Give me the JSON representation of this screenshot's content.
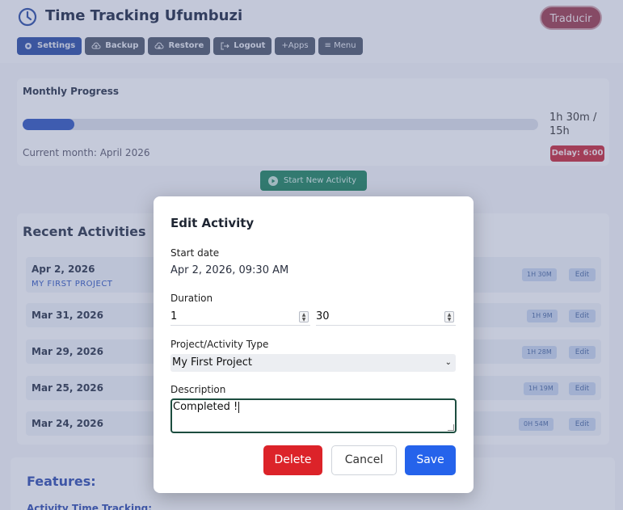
{
  "header": {
    "title": "Time Tracking Ufumbuzi",
    "translate_label": "Traducir",
    "toolbar": [
      {
        "label": "Settings",
        "icon": "gear-icon"
      },
      {
        "label": "Backup",
        "icon": "cloud-upload-icon"
      },
      {
        "label": "Restore",
        "icon": "cloud-download-icon"
      },
      {
        "label": "Logout",
        "icon": "logout-icon"
      },
      {
        "label": "+Apps",
        "icon": ""
      },
      {
        "label": "≡ Menu",
        "icon": ""
      }
    ]
  },
  "progress": {
    "title": "Monthly Progress",
    "fraction": 0.1,
    "hours_label": "1h 30m / 15h",
    "month_label": "Current month: April 2026",
    "delay_label": "Delay: 6:00"
  },
  "start_activity_label": "Start New Activity",
  "recent": {
    "title": "Recent Activities",
    "edit_label": "Edit",
    "rows": [
      {
        "date": "Apr 2, 2026",
        "project": "MY FIRST PROJECT",
        "duration": "1H 30M"
      },
      {
        "date": "Mar 31, 2026",
        "project": "",
        "duration": "1H 9M"
      },
      {
        "date": "Mar 29, 2026",
        "project": "",
        "duration": "1H 28M"
      },
      {
        "date": "Mar 25, 2026",
        "project": "",
        "duration": "1H 19M"
      },
      {
        "date": "Mar 24, 2026",
        "project": "",
        "duration": "0H 54M"
      }
    ]
  },
  "features": {
    "title": "Features:",
    "subtitle": "Activity Time Tracking:"
  },
  "modal": {
    "title": "Edit Activity",
    "start_date_label": "Start date",
    "start_date_value": "Apr 2, 2026, 09:30 AM",
    "duration_label": "Duration",
    "hours_value": "1",
    "minutes_value": "30",
    "project_label": "Project/Activity Type",
    "project_value": "My First Project",
    "description_label": "Description",
    "description_value": "Completed !",
    "delete_label": "Delete",
    "cancel_label": "Cancel",
    "save_label": "Save"
  },
  "colors": {
    "primary": "#2563eb",
    "danger": "#dc2329",
    "success": "#2f8c6a"
  }
}
